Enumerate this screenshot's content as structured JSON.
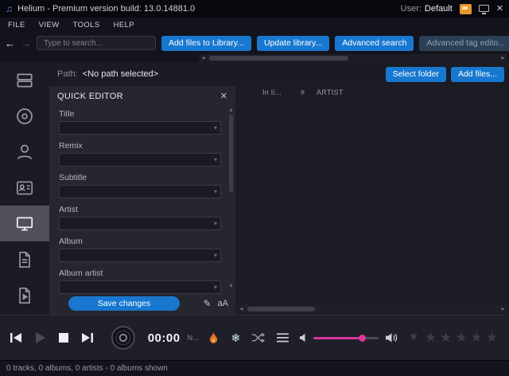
{
  "titlebar": {
    "title": "Helium - Premium version build: 13.0.14881.0",
    "user_label": "User:",
    "user_value": "Default"
  },
  "menu": {
    "items": [
      "FILE",
      "VIEW",
      "TOOLS",
      "HELP"
    ]
  },
  "toolbar": {
    "search_placeholder": "Type to search...",
    "buttons": [
      {
        "label": "Add files to Library...",
        "enabled": true
      },
      {
        "label": "Update library...",
        "enabled": true
      },
      {
        "label": "Advanced search",
        "enabled": true
      },
      {
        "label": "Advanced tag edito...",
        "enabled": false
      }
    ]
  },
  "path_row": {
    "label": "Path:",
    "value": "<No path selected>",
    "select_folder_label": "Select folder",
    "add_files_label": "Add files..."
  },
  "quick_editor": {
    "title": "QUICK EDITOR",
    "fields": [
      {
        "label": "Title"
      },
      {
        "label": "Remix"
      },
      {
        "label": "Subtitle"
      },
      {
        "label": "Artist"
      },
      {
        "label": "Album"
      },
      {
        "label": "Album artist"
      }
    ],
    "save_label": "Save changes",
    "font_size_label": "aA"
  },
  "table": {
    "columns": [
      "In li...",
      "#",
      "ARTIST"
    ]
  },
  "player": {
    "time": "00:00",
    "now_text": "N...",
    "stars": "★★★★★"
  },
  "statusbar": {
    "text": "0 tracks, 0 albums, 0 artists - 0 albums shown"
  },
  "icons": {
    "music_note": "♫",
    "back": "←",
    "forward": "→",
    "close": "✕",
    "dropdown": "▾",
    "scroll_left": "◂",
    "scroll_right": "▸",
    "scroll_up": "▴",
    "scroll_down": "▾",
    "pencil": "✎",
    "snowflake": "❄",
    "heart": "♥"
  },
  "colors": {
    "accent_blue": "#1878d0",
    "accent_pink": "#d8359e",
    "flame_orange": "#e06a28"
  }
}
